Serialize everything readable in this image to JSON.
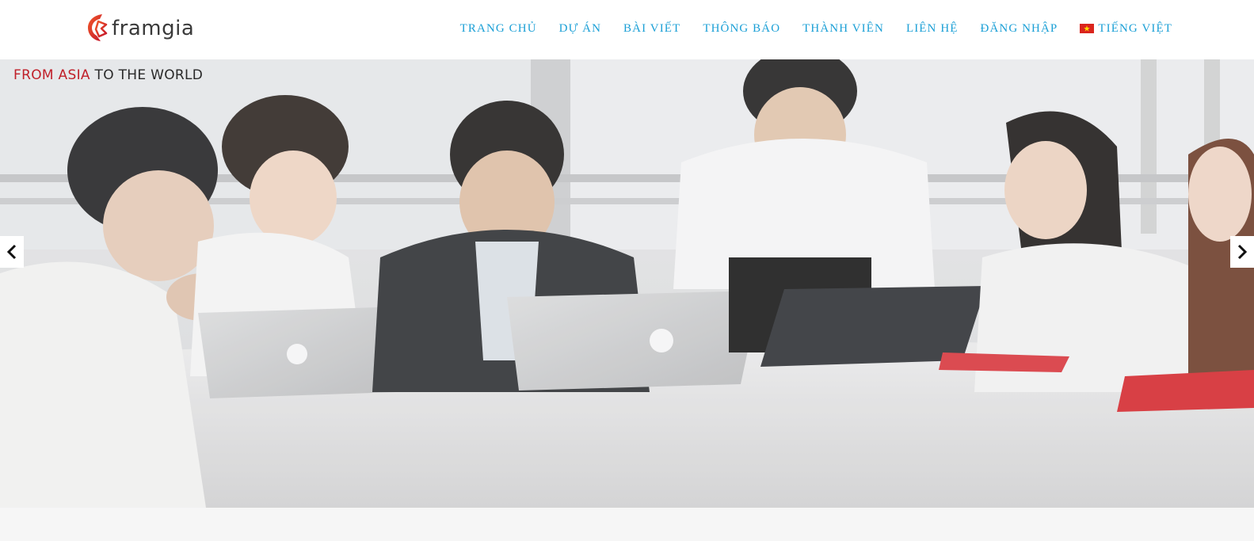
{
  "brand": {
    "name": "framgia",
    "logo_icon": "framgia-logo-icon",
    "accent": "#e8432a"
  },
  "nav": {
    "color": "#1a9fd6",
    "items": [
      {
        "label": "TRANG CHỦ"
      },
      {
        "label": "DỰ ÁN"
      },
      {
        "label": "BÀI VIẾT"
      },
      {
        "label": "THÔNG BÁO"
      },
      {
        "label": "THÀNH VIÊN"
      },
      {
        "label": "LIÊN HỆ"
      },
      {
        "label": "ĐĂNG NHẬP"
      }
    ],
    "language": {
      "label": "TIẾNG VIỆT",
      "icon": "vietnam-flag-icon"
    }
  },
  "hero": {
    "tagline_highlight": "FROM ASIA",
    "tagline_rest": " TO THE WORLD",
    "tagline_colors": {
      "highlight": "#c0202a",
      "rest": "#2a2a2a"
    },
    "image_description_icon": "team-meeting-photo",
    "prev_icon": "chevron-left-icon",
    "next_icon": "chevron-right-icon"
  }
}
